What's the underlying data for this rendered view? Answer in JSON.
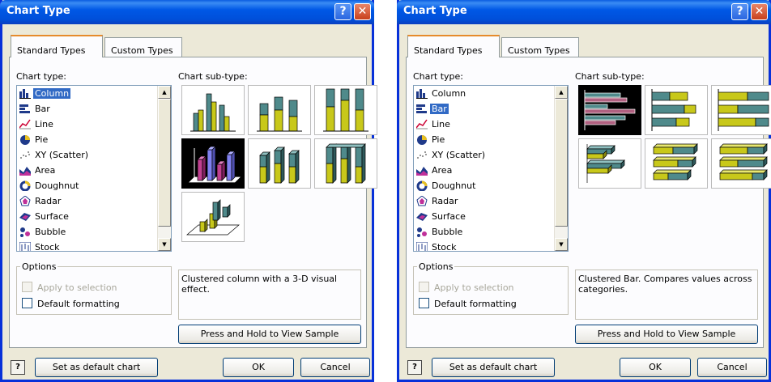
{
  "dialogs": [
    {
      "title": "Chart Type",
      "tabs": [
        "Standard Types",
        "Custom Types"
      ],
      "chart_type_label": "Chart type:",
      "chart_subtype_label": "Chart sub-type:",
      "chart_types": [
        "Column",
        "Bar",
        "Line",
        "Pie",
        "XY (Scatter)",
        "Area",
        "Doughnut",
        "Radar",
        "Surface",
        "Bubble",
        "Stock"
      ],
      "selected_type": "Column",
      "options_legend": "Options",
      "apply_to_selection": "Apply to selection",
      "default_formatting": "Default formatting",
      "description": "Clustered column with a 3-D visual effect.",
      "press_hold": "Press and Hold to View Sample",
      "set_default": "Set as default chart",
      "ok": "OK",
      "cancel": "Cancel"
    },
    {
      "title": "Chart Type",
      "tabs": [
        "Standard Types",
        "Custom Types"
      ],
      "chart_type_label": "Chart type:",
      "chart_subtype_label": "Chart sub-type:",
      "chart_types": [
        "Column",
        "Bar",
        "Line",
        "Pie",
        "XY (Scatter)",
        "Area",
        "Doughnut",
        "Radar",
        "Surface",
        "Bubble",
        "Stock"
      ],
      "selected_type": "Bar",
      "options_legend": "Options",
      "apply_to_selection": "Apply to selection",
      "default_formatting": "Default formatting",
      "description": "Clustered Bar. Compares values across categories.",
      "press_hold": "Press and Hold to View Sample",
      "set_default": "Set as default chart",
      "ok": "OK",
      "cancel": "Cancel"
    }
  ],
  "colors": {
    "titlebar": "#0054e3",
    "selection": "#316ac5",
    "bar_teal": "#4f8a8b",
    "bar_yellow": "#c8c81a"
  }
}
